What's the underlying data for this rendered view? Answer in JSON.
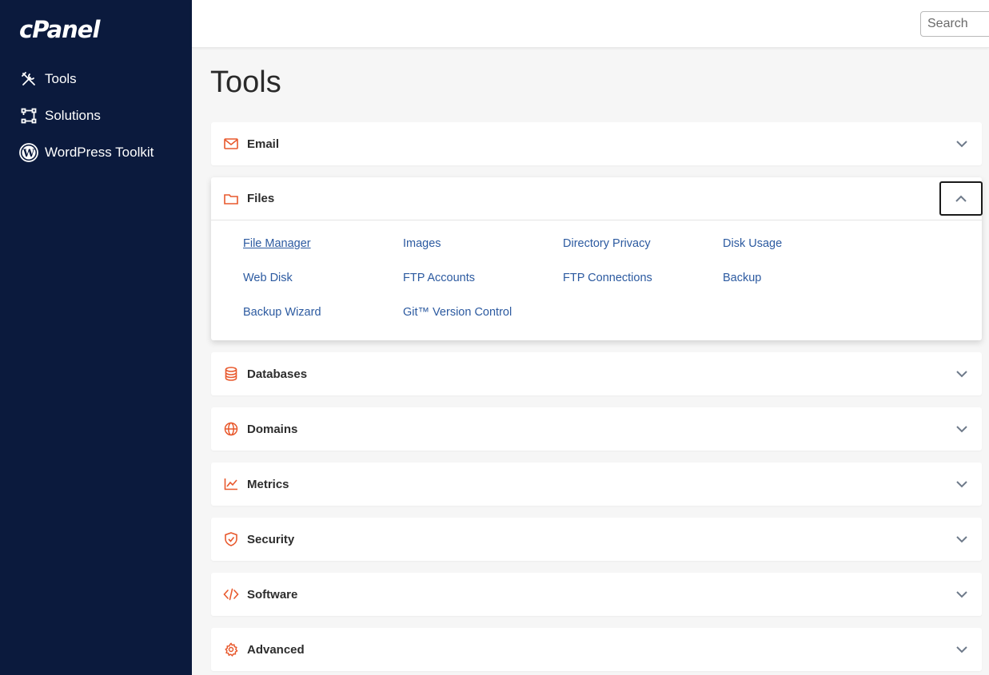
{
  "brand": {
    "logo_text": "cPanel"
  },
  "sidebar": {
    "items": [
      {
        "label": "Tools",
        "icon": "tools-icon"
      },
      {
        "label": "Solutions",
        "icon": "solutions-icon"
      },
      {
        "label": "WordPress Toolkit",
        "icon": "wordpress-icon"
      }
    ]
  },
  "topbar": {
    "search_placeholder": "Search"
  },
  "main": {
    "title": "Tools",
    "sections": [
      {
        "title": "Email",
        "icon": "mail-icon",
        "expanded": false
      },
      {
        "title": "Files",
        "icon": "folder-icon",
        "expanded": true,
        "links": [
          "File Manager",
          "Images",
          "Directory Privacy",
          "Disk Usage",
          "Web Disk",
          "FTP Accounts",
          "FTP Connections",
          "Backup",
          "Backup Wizard",
          "Git™ Version Control"
        ]
      },
      {
        "title": "Databases",
        "icon": "database-icon",
        "expanded": false
      },
      {
        "title": "Domains",
        "icon": "globe-icon",
        "expanded": false
      },
      {
        "title": "Metrics",
        "icon": "chart-icon",
        "expanded": false
      },
      {
        "title": "Security",
        "icon": "shield-icon",
        "expanded": false
      },
      {
        "title": "Software",
        "icon": "code-icon",
        "expanded": false
      },
      {
        "title": "Advanced",
        "icon": "gear-icon",
        "expanded": false
      }
    ]
  },
  "colors": {
    "sidebar_bg": "#0b1a3d",
    "accent": "#e8592d",
    "link": "#2c5aa0",
    "page_bg": "#f6f6f6"
  }
}
